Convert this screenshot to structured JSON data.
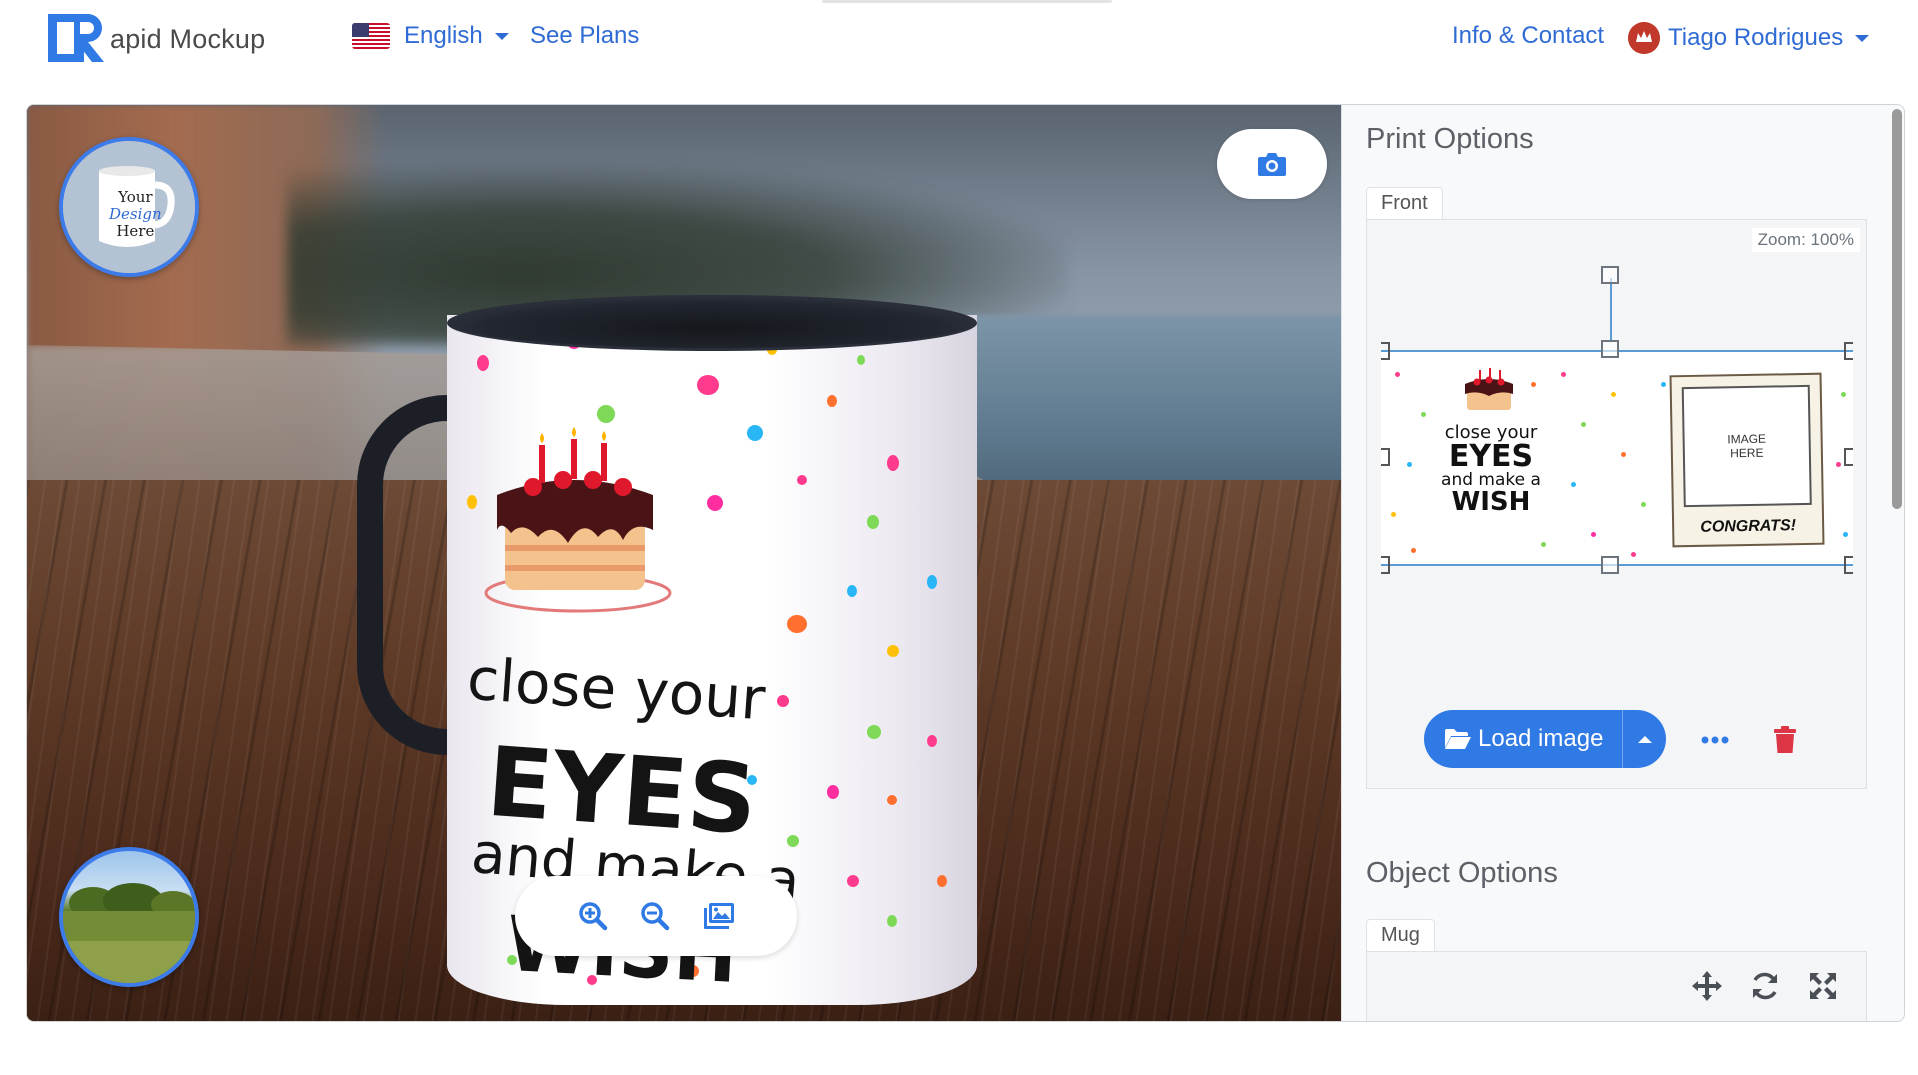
{
  "navbar": {
    "brand_text": "apid Mockup",
    "brand_logo_letter": "R",
    "language": "English",
    "see_plans": "See Plans",
    "info_contact": "Info & Contact",
    "user_name": "Tiago Rodrigues"
  },
  "scene": {
    "mug_print": {
      "line1": "close your",
      "line2": "EYES",
      "line3": "and make a",
      "line4": "WISH"
    },
    "mug_thumb_text": [
      "Your",
      "Design",
      "Here"
    ]
  },
  "print_options": {
    "title": "Print Options",
    "tab": "Front",
    "zoom_label": "Zoom: 100%",
    "design": {
      "line1": "close your",
      "line2": "EYES",
      "line3": "and make a",
      "line4": "WISH",
      "image_placeholder": "IMAGE\nHERE",
      "caption": "CONGRATS!"
    },
    "load_button": "Load image"
  },
  "object_options": {
    "title": "Object Options",
    "tab": "Mug"
  },
  "colors": {
    "accent": "#2f7ae5",
    "link": "#2f6bd4",
    "delete": "#dc3545",
    "thumb_border": "#3d7be8"
  }
}
